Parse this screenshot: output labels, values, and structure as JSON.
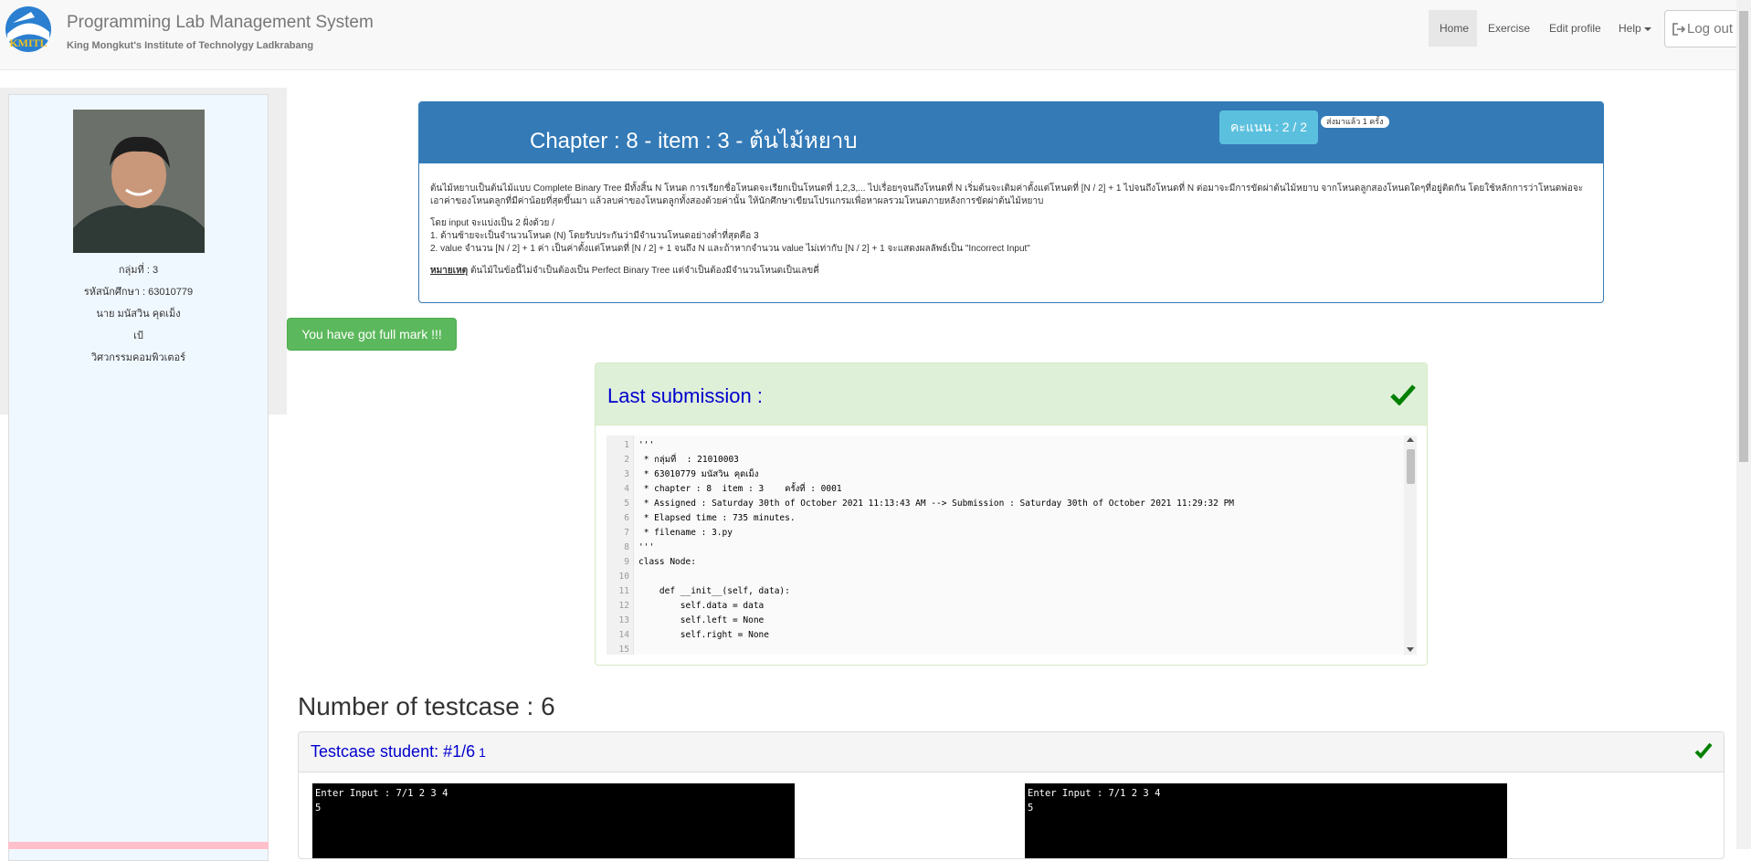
{
  "header": {
    "brand_title": "Programming Lab Management System",
    "brand_subtitle": "King Mongkut's Institute of Technolygy Ladkrabang",
    "logo_text": "KMITL",
    "nav": {
      "home": "Home",
      "exercise": "Exercise",
      "edit_profile": "Edit profile",
      "help": "Help",
      "logout": "Log out"
    }
  },
  "sidebar": {
    "group": "กลุ่มที่ : 3",
    "student_id": "รหัสนักศึกษา : 63010779",
    "name": "นาย มนัสวิน คุดเม็ง",
    "nickname": "เป้",
    "department": "วิศวกรรมคอมพิวเตอร์"
  },
  "problem": {
    "title": "Chapter : 8 - item : 3 - ต้นไม้หยาบ",
    "score": "คะแนน : 2 / 2",
    "sent_badge": "ส่งมาแล้ว 1 ครั้ง",
    "description": "ต้นไม้หยาบเป็นต้นไม้แบบ Complete Binary Tree มีทั้งสิ้น N โหนด การเรียกชื่อโหนดจะเรียกเป็นโหนดที่ 1,2,3,... ไปเรื่อยๆจนถึงโหนดที่ N เริ่มต้นจะเติมค่าตั้งแต่โหนดที่ [N / 2] + 1 ไปจนถึงโหนดที่ N ต่อมาจะมีการขัดผ่าต้นไม้หยาบ จากโหนดลูกสองโหนดใดๆที่อยู่ติดกัน โดยใช้หลักการว่าโหนดพ่อจะเอาค่าของโหนดลูกที่มีค่าน้อยที่สุดขึ้นมา แล้วลบค่าของโหนดลูกทั้งสองด้วยค่านั้น ให้นักศึกษาเขียนโปรแกรมเพื่อหาผลรวมโหนดภายหลังการขัดผ่าต้นไม้หยาบ",
    "input_intro": "โดย input จะแบ่งเป็น 2 ฝั่งด้วย /",
    "input_1": "1. ด้านซ้ายจะเป็นจำนวนโหนด (N) โดยรับประกันว่ามีจำนวนโหนดอย่างต่ำที่สุดคือ 3",
    "input_2": "2. value จำนวน [N / 2] + 1 ค่า เป็นค่าตั้งแต่โหนดที่ [N / 2] + 1 จนถึง N และถ้าหากจำนวน value ไม่เท่ากับ [N / 2] + 1 จะแสดงผลลัพธ์เป็น \"Incorrect Input\"",
    "note_label": "หมายเหตุ",
    "note_text": " ต้นไม้ในข้อนี้ไม่จำเป็นต้องเป็น Perfect Binary Tree แต่จำเป็นต้องมีจำนวนโหนดเป็นเลขคี่"
  },
  "full_mark": "You have got full mark !!!",
  "submission": {
    "title": "Last submission :",
    "lines": [
      {
        "n": "1",
        "t": "'''"
      },
      {
        "n": "2",
        "t": " * กลุ่มที่  : 21010003"
      },
      {
        "n": "3",
        "t": " * 63010779 มนัสวิน คุดเม็ง"
      },
      {
        "n": "4",
        "t": " * chapter : 8  item : 3    ครั้งที่ : 0001"
      },
      {
        "n": "5",
        "t": " * Assigned : Saturday 30th of October 2021 11:13:43 AM --> Submission : Saturday 30th of October 2021 11:29:32 PM"
      },
      {
        "n": "6",
        "t": " * Elapsed time : 735 minutes."
      },
      {
        "n": "7",
        "t": " * filename : 3.py"
      },
      {
        "n": "8",
        "t": "'''"
      },
      {
        "n": "9",
        "t": "class Node:"
      },
      {
        "n": "10",
        "t": ""
      },
      {
        "n": "11",
        "t": "    def __init__(self, data):"
      },
      {
        "n": "12",
        "t": "        self.data = data"
      },
      {
        "n": "13",
        "t": "        self.left = None"
      },
      {
        "n": "14",
        "t": "        self.right = None"
      },
      {
        "n": "15",
        "t": ""
      }
    ]
  },
  "testcases": {
    "heading": "Number of testcase : 6",
    "item_title": "Testcase student: #1/6",
    "item_number": "1",
    "expected_output": "Enter Input : 7/1 2 3 4\n5",
    "student_output": "Enter Input : 7/1 2 3 4\n5"
  },
  "colors": {
    "primary": "#337ab7",
    "success": "#5cb85c",
    "info": "#5bc0de",
    "check": "#008000",
    "link_blue": "#0000cd"
  }
}
